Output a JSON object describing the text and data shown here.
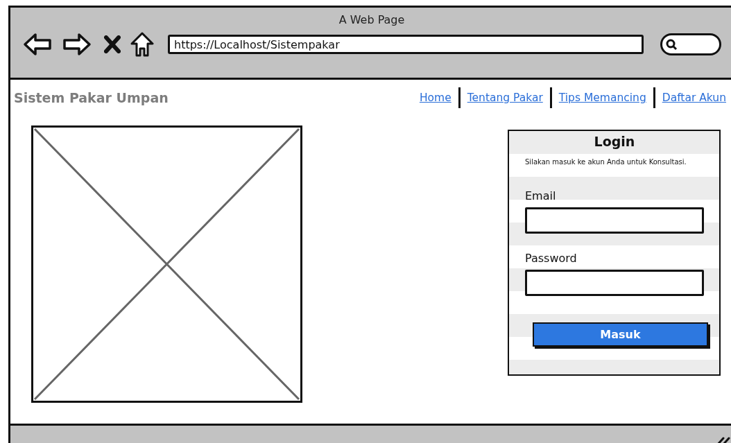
{
  "browser": {
    "title": "A Web Page",
    "url": "https://Localhost/Sistempakar"
  },
  "site": {
    "brand": "Sistem Pakar Umpan",
    "nav": [
      {
        "label": "Home"
      },
      {
        "label": "Tentang Pakar"
      },
      {
        "label": "Tips Memancing"
      },
      {
        "label": "Daftar Akun"
      }
    ]
  },
  "login": {
    "title": "Login",
    "subtitle": "Silakan masuk ke akun Anda untuk Konsultasi.",
    "fields": [
      {
        "label": "Email"
      },
      {
        "label": "Password"
      }
    ],
    "button": "Masuk"
  }
}
